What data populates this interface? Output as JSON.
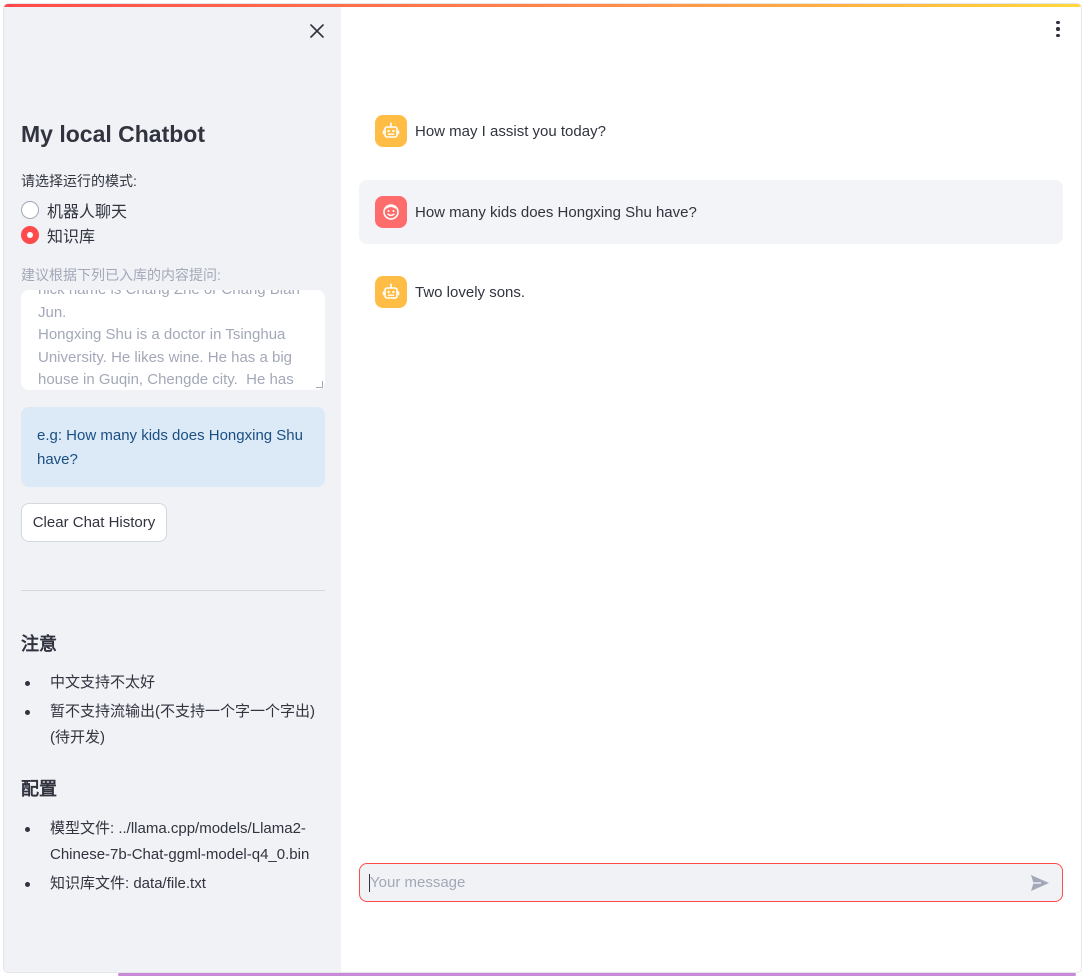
{
  "sidebar": {
    "title": "My local Chatbot",
    "mode_label": "请选择运行的模式:",
    "mode_options": [
      {
        "label": "机器人聊天",
        "selected": false
      },
      {
        "label": "知识库",
        "selected": true
      }
    ],
    "kb_hint_label": "建议根据下列已入库的内容提问:",
    "kb_textarea_value": "nick name is Chang Zhe or Chang Bian Jun.\nHongxing Shu is a doctor in Tsinghua University. He likes wine. He has a big house in Guqin, Chengde city.  He has",
    "example_info": "e.g: How many kids does Hongxing Shu have?",
    "clear_button": "Clear Chat History",
    "note_heading": "注意",
    "note_items": [
      "中文支持不太好",
      "暂不支持流输出(不支持一个字一个字出)(待开发)"
    ],
    "config_heading": "配置",
    "config_items": [
      "模型文件: ../llama.cpp/models/Llama2-Chinese-7b-Chat-ggml-model-q4_0.bin",
      "知识库文件: data/file.txt"
    ]
  },
  "chat": {
    "messages": [
      {
        "role": "assistant",
        "text": "How may I assist you today?"
      },
      {
        "role": "user",
        "text": "How many kids does Hongxing Shu have?"
      },
      {
        "role": "assistant",
        "text": "Two lovely sons."
      }
    ],
    "input_placeholder": "Your message"
  },
  "colors": {
    "primary": "#ff4b4b",
    "sidebar_bg": "#f0f2f6",
    "bot_avatar": "#ffbd45",
    "user_avatar": "#ff6c6c",
    "info_bg": "#dce9f7",
    "info_text": "#1a4f82"
  },
  "icons": {
    "close": "close-icon",
    "menu": "kebab-menu-icon",
    "bot_avatar": "robot-icon",
    "user_avatar": "smiley-face-icon",
    "send": "send-icon"
  }
}
